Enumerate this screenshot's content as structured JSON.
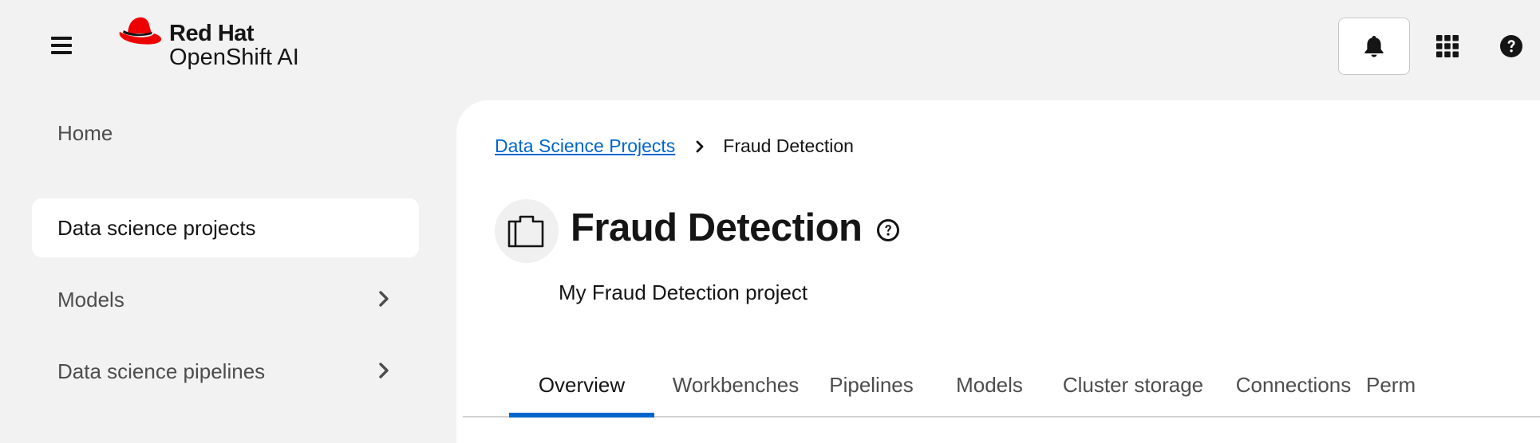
{
  "app": {
    "brand_line1": "Red Hat",
    "brand_line2": "OpenShift AI"
  },
  "masthead": {
    "icons": [
      "hamburger-menu-icon",
      "bell-icon",
      "apps-grid-icon",
      "help-icon"
    ]
  },
  "sidebar": {
    "items": [
      {
        "label": "Home",
        "active": false,
        "expandable": false
      },
      {
        "label": "Data science projects",
        "active": true,
        "expandable": false
      },
      {
        "label": "Models",
        "active": false,
        "expandable": true
      },
      {
        "label": "Data science pipelines",
        "active": false,
        "expandable": true
      }
    ]
  },
  "breadcrumb": {
    "parent": "Data Science Projects",
    "current": "Fraud Detection"
  },
  "project": {
    "title": "Fraud Detection",
    "description": "My Fraud Detection project"
  },
  "tabs": [
    {
      "label": "Overview",
      "active": true
    },
    {
      "label": "Workbenches",
      "active": false
    },
    {
      "label": "Pipelines",
      "active": false
    },
    {
      "label": "Models",
      "active": false
    },
    {
      "label": "Cluster storage",
      "active": false
    },
    {
      "label": "Connections",
      "active": false
    },
    {
      "label": "Perm",
      "active": false
    }
  ],
  "colors": {
    "accent": "#0066cc",
    "brand_red": "#ee0000",
    "background": "#f2f2f2"
  }
}
